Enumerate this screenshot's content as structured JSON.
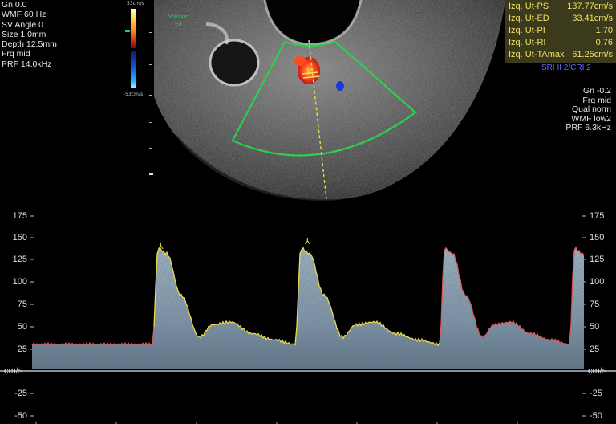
{
  "left_params": {
    "gn": "Gn  0.0",
    "wmf": "WMF 60 Hz",
    "sv_angle": "SV Angle  0",
    "size": "Size  1.0mm",
    "depth": "Depth 12.5mm",
    "frq": "Frq mid",
    "prf": "PRF 14.0kHz"
  },
  "color_scale": {
    "top": "53cm/s",
    "bottom": "-53cm/s"
  },
  "probe_badge": {
    "line1": "Voluson",
    "line2": "E8"
  },
  "measurements": [
    {
      "label": "Izq. Ut-PS",
      "value": "137.77cm/s"
    },
    {
      "label": "Izq. Ut-ED",
      "value": "33.41cm/s"
    },
    {
      "label": "Izq. Ut-PI",
      "value": "1.70"
    },
    {
      "label": "Izq. Ut-RI",
      "value": "0.76"
    },
    {
      "label": "Izq. Ut-TAmax",
      "value": "61.25cm/s"
    }
  ],
  "sri": "SRI II 2/CRI 2",
  "right_params": [
    "Gn -0.2",
    "Frq mid",
    "Qual norm",
    "WMF low2",
    "PRF  6.3kHz"
  ],
  "velocity_axis": {
    "unit": "cm/s",
    "ticks": [
      "175",
      "150",
      "125",
      "100",
      "75",
      "50",
      "25",
      "-25",
      "-50"
    ]
  },
  "colors": {
    "sector_outline": "#29d24a",
    "cursor_line": "#e8d84a",
    "envelope_trace": "#e8d84a",
    "envelope_red": "#d85a5a",
    "measure_text": "#f0e060",
    "measure_box": "#3b3a1c",
    "sri_text": "#6a6cff"
  }
}
